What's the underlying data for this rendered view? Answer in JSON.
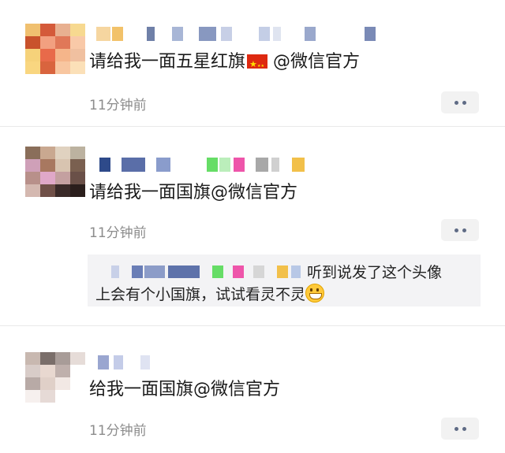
{
  "posts": [
    {
      "content": "请给我一面五星红旗",
      "mention": " @微信官方",
      "time": "11分钟前"
    },
    {
      "content": "请给我一面国旗@微信官方",
      "time": "11分钟前"
    },
    {
      "content": "给我一面国旗@微信官方",
      "time": "11分钟前"
    }
  ],
  "comment": {
    "line1": "听到说发了这个头像",
    "line2": "上会有个小国旗，试试看灵不灵"
  },
  "icons": {
    "flag": "china-flag-emoji",
    "grin": "grinning-face-emoji",
    "more": "more-dots-icon"
  },
  "colors": {
    "accent_link": "#5f6b85",
    "time_gray": "#8c8c8c"
  }
}
